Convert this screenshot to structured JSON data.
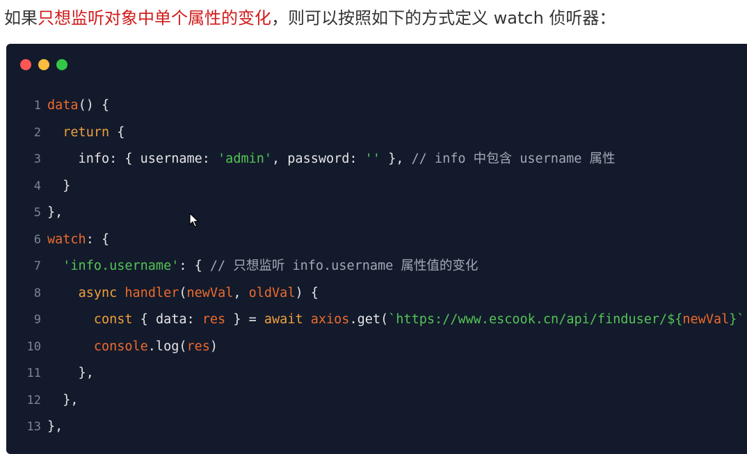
{
  "intro": {
    "prefix": "如果",
    "highlight": "只想监听对象中单个属性的变化",
    "suffix": "，则可以按照如下的方式定义 watch 侦听器："
  },
  "code_window": {
    "dots": [
      "red",
      "yellow",
      "green"
    ],
    "colors": {
      "background": "#131a2c",
      "dot_red": "#fc5753",
      "dot_yellow": "#fdbc40",
      "dot_green": "#33c748"
    },
    "lines": [
      {
        "n": "1",
        "tokens": [
          {
            "t": "data",
            "c": "fn"
          },
          {
            "t": "() {",
            "c": "p"
          }
        ]
      },
      {
        "n": "2",
        "tokens": [
          {
            "t": "  ",
            "c": "p"
          },
          {
            "t": "return",
            "c": "kw"
          },
          {
            "t": " {",
            "c": "p"
          }
        ]
      },
      {
        "n": "3",
        "tokens": [
          {
            "t": "    info: { username: ",
            "c": "p"
          },
          {
            "t": "'admin'",
            "c": "str"
          },
          {
            "t": ", password: ",
            "c": "p"
          },
          {
            "t": "''",
            "c": "str"
          },
          {
            "t": " }, ",
            "c": "p"
          },
          {
            "t": "// info 中包含 username 属性",
            "c": "cmt"
          }
        ]
      },
      {
        "n": "4",
        "tokens": [
          {
            "t": "  }",
            "c": "p"
          }
        ]
      },
      {
        "n": "5",
        "tokens": [
          {
            "t": "},",
            "c": "p"
          }
        ]
      },
      {
        "n": "6",
        "tokens": [
          {
            "t": "watch",
            "c": "fn"
          },
          {
            "t": ": {",
            "c": "p"
          }
        ]
      },
      {
        "n": "7",
        "tokens": [
          {
            "t": "  ",
            "c": "p"
          },
          {
            "t": "'info.username'",
            "c": "str"
          },
          {
            "t": ": { ",
            "c": "p"
          },
          {
            "t": "// 只想监听 info.username 属性值的变化",
            "c": "cmt"
          }
        ]
      },
      {
        "n": "8",
        "tokens": [
          {
            "t": "    ",
            "c": "p"
          },
          {
            "t": "async",
            "c": "kw"
          },
          {
            "t": " ",
            "c": "p"
          },
          {
            "t": "handler",
            "c": "fn"
          },
          {
            "t": "(",
            "c": "p"
          },
          {
            "t": "newVal",
            "c": "var"
          },
          {
            "t": ", ",
            "c": "p"
          },
          {
            "t": "oldVal",
            "c": "var"
          },
          {
            "t": ") {",
            "c": "p"
          }
        ]
      },
      {
        "n": "9",
        "tokens": [
          {
            "t": "      ",
            "c": "p"
          },
          {
            "t": "const",
            "c": "kw"
          },
          {
            "t": " { data: ",
            "c": "p"
          },
          {
            "t": "res",
            "c": "var"
          },
          {
            "t": " } = ",
            "c": "p"
          },
          {
            "t": "await",
            "c": "kw"
          },
          {
            "t": " ",
            "c": "p"
          },
          {
            "t": "axios",
            "c": "fn"
          },
          {
            "t": ".get(",
            "c": "p"
          },
          {
            "t": "`https://www.escook.cn/api/finduser/${",
            "c": "str"
          },
          {
            "t": "newVal",
            "c": "var"
          },
          {
            "t": "}`",
            "c": "str"
          },
          {
            "t": ")",
            "c": "p"
          }
        ]
      },
      {
        "n": "10",
        "tokens": [
          {
            "t": "      ",
            "c": "p"
          },
          {
            "t": "console",
            "c": "fn"
          },
          {
            "t": ".log(",
            "c": "p"
          },
          {
            "t": "res",
            "c": "var"
          },
          {
            "t": ")",
            "c": "p"
          }
        ]
      },
      {
        "n": "11",
        "tokens": [
          {
            "t": "    },",
            "c": "p"
          }
        ]
      },
      {
        "n": "12",
        "tokens": [
          {
            "t": "  },",
            "c": "p"
          }
        ]
      },
      {
        "n": "13",
        "tokens": [
          {
            "t": "},",
            "c": "p"
          }
        ]
      }
    ]
  }
}
